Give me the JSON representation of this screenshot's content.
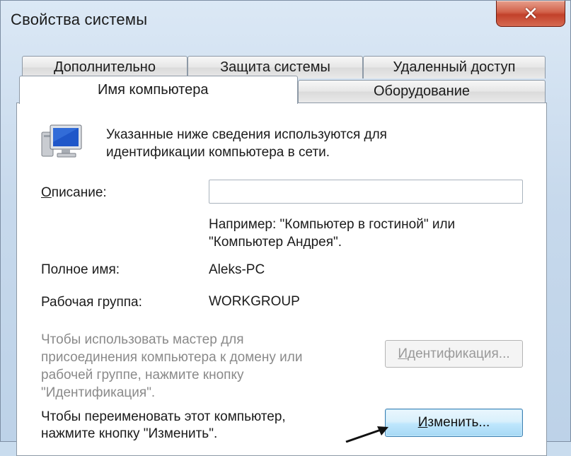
{
  "window": {
    "title": "Свойства системы",
    "close_glyph": "✕"
  },
  "tabs": {
    "row_back": [
      {
        "label": "Дополнительно"
      },
      {
        "label": "Защита системы"
      },
      {
        "label": "Удаленный доступ"
      }
    ],
    "row_front": [
      {
        "label": "Имя компьютера",
        "active": true
      },
      {
        "label": "Оборудование",
        "active": false
      }
    ]
  },
  "panel": {
    "icon": "computer-monitor-icon",
    "intro_line1": "Указанные ниже сведения используются для",
    "intro_line2": "идентификации компьютера в сети.",
    "description_label_first": "О",
    "description_label_rest": "писание:",
    "description_value": "",
    "example_line1": "Например: \"Компьютер в гостиной\" или",
    "example_line2": "\"Компьютер Андрея\".",
    "full_name_label": "Полное имя:",
    "full_name_value": "Aleks-PC",
    "workgroup_label": "Рабочая группа:",
    "workgroup_value": "WORKGROUP",
    "wizard_line1": "Чтобы использовать мастер для",
    "wizard_line2": "присоединения компьютера к домену или",
    "wizard_line3": "рабочей группе, нажмите кнопку",
    "wizard_line4": "\"Идентификация\".",
    "identify_button_first": "И",
    "identify_button_rest": "дентификация...",
    "rename_line1": "Чтобы переименовать этот компьютер,",
    "rename_line2": "нажмите кнопку \"Изменить\".",
    "change_button_first": "И",
    "change_button_rest": "зменить..."
  },
  "colors": {
    "accent": "#3c7fb1",
    "close_red": "#c2412a",
    "disabled_text": "#8a8a8a"
  }
}
